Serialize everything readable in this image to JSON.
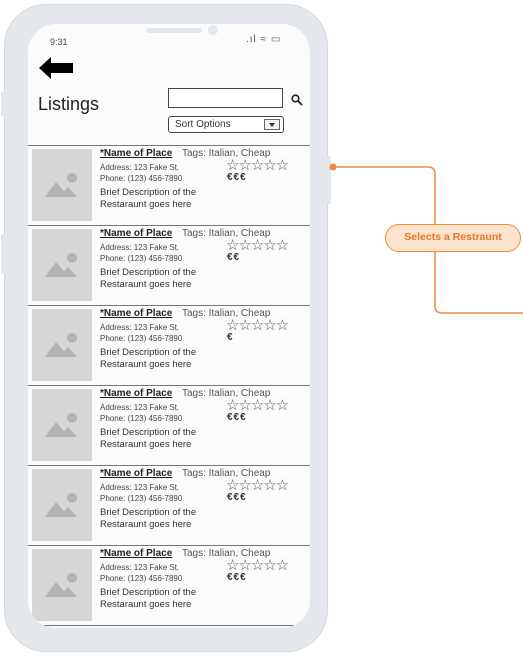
{
  "status_bar": {
    "time": "9:31",
    "icons_text": ".ıl ≈ ▭"
  },
  "page": {
    "title": "Listings"
  },
  "search": {
    "placeholder": "",
    "icon": "search-icon"
  },
  "sort": {
    "label": "Sort Options"
  },
  "listings": [
    {
      "name": "*Name of Place",
      "tags": "Tags: Italian, Cheap",
      "address": "Address: 123 Fake St.",
      "phone": "Phone: (123) 456-7890",
      "description": "Brief Description of the Restaraunt goes here",
      "stars": "☆☆☆☆☆",
      "price": "€€€"
    },
    {
      "name": "*Name of Place",
      "tags": "Tags: Italian, Cheap",
      "address": "Address: 123 Fake St.",
      "phone": "Phone: (123) 456-7890",
      "description": "Brief Description of the Restaraunt goes here",
      "stars": "☆☆☆☆☆",
      "price": "€€"
    },
    {
      "name": "*Name of Place",
      "tags": "Tags: Italian, Cheap",
      "address": "Address: 123 Fake St.",
      "phone": "Phone: (123) 456-7890",
      "description": "Brief Description of the Restaraunt goes here",
      "stars": "☆☆☆☆☆",
      "price": "€"
    },
    {
      "name": "*Name of Place",
      "tags": "Tags: Italian, Cheap",
      "address": "Address: 123 Fake St.",
      "phone": "Phone: (123) 456-7890",
      "description": "Brief Description of the Restaraunt goes here",
      "stars": "☆☆☆☆☆",
      "price": "€€€"
    },
    {
      "name": "*Name of Place",
      "tags": "Tags: Italian, Cheap",
      "address": "Address: 123 Fake St.",
      "phone": "Phone: (123) 456-7890",
      "description": "Brief Description of the Restaraunt goes here",
      "stars": "☆☆☆☆☆",
      "price": "€€€"
    },
    {
      "name": "*Name of Place",
      "tags": "Tags: Italian, Cheap",
      "address": "Address: 123 Fake St.",
      "phone": "Phone: (123) 456-7890",
      "description": "Brief Description of the Restaraunt goes here",
      "stars": "☆☆☆☆☆",
      "price": "€€€"
    }
  ],
  "annotation": {
    "label": "Selects a Restraunt"
  },
  "colors": {
    "accent": "#ee8a3f",
    "badge_bg": "#fde3cc",
    "phone_frame": "#e4e7ec",
    "thumb_bg": "#d6d6d6"
  }
}
